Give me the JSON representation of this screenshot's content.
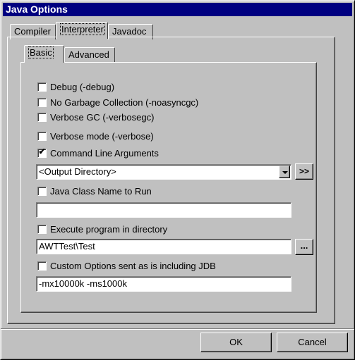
{
  "window": {
    "title": "Java Options"
  },
  "outer_tabs": [
    {
      "label": "Compiler"
    },
    {
      "label": "Interpreter"
    },
    {
      "label": "Javadoc"
    }
  ],
  "inner_tabs": [
    {
      "label": "Basic"
    },
    {
      "label": "Advanced"
    }
  ],
  "options": {
    "debug": {
      "label": "Debug (-debug)",
      "checked": false
    },
    "no_gc": {
      "label": "No Garbage Collection (-noasyncgc)",
      "checked": false
    },
    "verbose_gc": {
      "label": "Verbose GC (-verbosegc)",
      "checked": false
    },
    "verbose_mode": {
      "label": "Verbose mode (-verbose)",
      "checked": false
    },
    "cmd_args": {
      "label": "Command Line Arguments",
      "checked": true,
      "value": "<Output Directory>",
      "button": ">>"
    },
    "class_name": {
      "label": "Java Class Name to Run",
      "checked": false,
      "value": ""
    },
    "exec_dir": {
      "label": "Execute program in directory",
      "checked": false,
      "value": "AWTTest\\Test",
      "button": "..."
    },
    "custom": {
      "label": "Custom Options sent as is including JDB",
      "checked": false,
      "value": "-mx10000k -ms1000k"
    }
  },
  "buttons": {
    "ok": "OK",
    "cancel": "Cancel"
  },
  "glyphs": {
    "check": "✔"
  }
}
